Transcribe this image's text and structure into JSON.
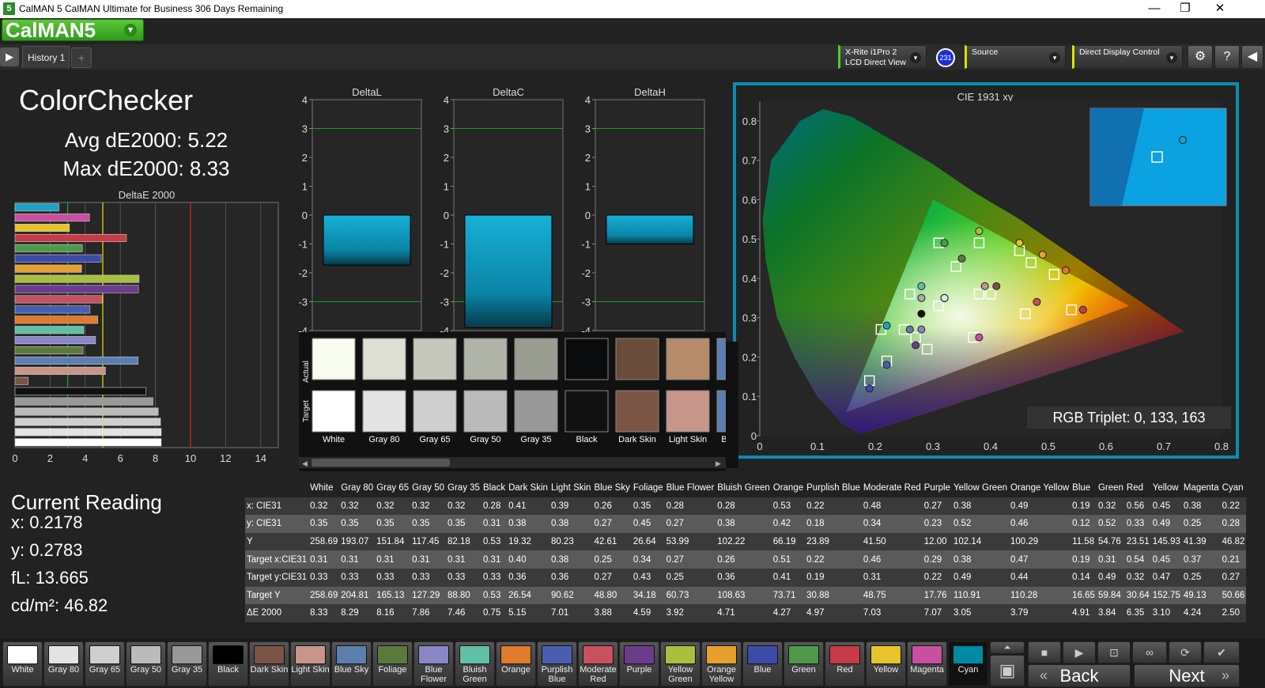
{
  "titlebar": {
    "title": "CalMAN 5 CalMAN Ultimate for Business 306 Days Remaining",
    "app_badge": "5",
    "minimize": "—",
    "restore": "❐",
    "close": "✕"
  },
  "logo": {
    "text": "CalMAN5",
    "dropdown": "▾"
  },
  "tabs": {
    "play": "▶",
    "history": "History 1",
    "add": "+"
  },
  "devices": {
    "meter_line1": "X-Rite i1Pro 2",
    "meter_line2": "LCD Direct View",
    "meter_badge": "231",
    "source": "Source",
    "display": "Direct Display Control",
    "chev": "▾"
  },
  "toolbar_icons": [
    "gear-icon",
    "help-icon",
    "collapse-icon"
  ],
  "toolbar_glyphs": {
    "gear": "⚙",
    "help": "?",
    "collapse": "◀"
  },
  "summary": {
    "title": "ColorChecker",
    "avg": "Avg dE2000: 5.22",
    "max": "Max dE2000: 8.33"
  },
  "current_reading": {
    "title": "Current Reading",
    "x": "x: 0.2178",
    "y": "y: 0.2783",
    "fl": "fL: 13.665",
    "cdm2": "cd/m²: 46.82"
  },
  "chart_data": [
    {
      "type": "bar",
      "title": "DeltaE 2000",
      "orientation": "horizontal",
      "xlim": [
        0,
        15
      ],
      "xticks": [
        0,
        2,
        4,
        6,
        8,
        10,
        12,
        14
      ],
      "reference_lines": [
        {
          "value": 3,
          "color": "#22aa22"
        },
        {
          "value": 5,
          "color": "#e8e000"
        },
        {
          "value": 10,
          "color": "#dd2222"
        }
      ],
      "categories": [
        "Cyan",
        "Magenta",
        "Yellow",
        "Red",
        "Green",
        "Blue",
        "Orange Yellow",
        "Yellow Green",
        "Purple",
        "Moderate Red",
        "Purplish Blue",
        "Orange",
        "Bluish Green",
        "Blue Flower",
        "Foliage",
        "Blue Sky",
        "Light Skin",
        "Dark Skin",
        "Black",
        "Gray 35",
        "Gray 50",
        "Gray 65",
        "Gray 80",
        "White"
      ],
      "values": [
        2.5,
        4.24,
        3.1,
        6.35,
        3.84,
        4.91,
        3.79,
        7.07,
        7.03,
        4.97,
        4.27,
        4.71,
        3.92,
        4.59,
        3.88,
        7.01,
        5.15,
        0.75,
        7.46,
        7.86,
        8.16,
        8.29,
        8.33,
        8.33
      ],
      "colors": [
        "#1ba3c6",
        "#c94fa0",
        "#e8c42a",
        "#c73a48",
        "#4e9a4a",
        "#3c4ba8",
        "#e7a02e",
        "#a8c03d",
        "#6b3c8c",
        "#c8505f",
        "#4a5db0",
        "#e07a2c",
        "#5fc0a8",
        "#8a86c8",
        "#5a7a3c",
        "#5c7fb0",
        "#c8958a",
        "#7a5444",
        "#111111",
        "#999999",
        "#bbbbbb",
        "#cfcfcf",
        "#e3e3e3",
        "#ffffff"
      ]
    },
    {
      "type": "bar",
      "title": "DeltaL",
      "ylim": [
        -4,
        4
      ],
      "yticks": [
        4,
        3,
        2,
        1,
        0,
        -1,
        -2,
        -3,
        -4
      ],
      "values": [
        -1.73
      ]
    },
    {
      "type": "bar",
      "title": "DeltaC",
      "ylim": [
        -4,
        4
      ],
      "yticks": [
        4,
        3,
        2,
        1,
        0,
        -1,
        -2,
        -3,
        -4
      ],
      "values": [
        -3.9
      ]
    },
    {
      "type": "bar",
      "title": "DeltaH",
      "ylim": [
        -4,
        4
      ],
      "yticks": [
        4,
        3,
        2,
        1,
        0,
        -1,
        -2,
        -3,
        -4
      ],
      "values": [
        -1.0
      ]
    },
    {
      "type": "scatter",
      "title": "CIE 1931 xy",
      "xlim": [
        0,
        0.8
      ],
      "ylim": [
        0,
        0.85
      ],
      "xticks": [
        0,
        0.1,
        0.2,
        0.3,
        0.4,
        0.5,
        0.6,
        0.7,
        0.8
      ],
      "yticks": [
        0,
        0.1,
        0.2,
        0.3,
        0.4,
        0.5,
        0.6,
        0.7,
        0.8
      ],
      "gamut": [
        [
          0.64,
          0.33
        ],
        [
          0.3,
          0.6
        ],
        [
          0.15,
          0.06
        ]
      ],
      "actual": [
        [
          0.22,
          0.28
        ],
        [
          0.38,
          0.25
        ],
        [
          0.45,
          0.49
        ],
        [
          0.56,
          0.32
        ],
        [
          0.32,
          0.49
        ],
        [
          0.19,
          0.12
        ],
        [
          0.49,
          0.46
        ],
        [
          0.38,
          0.52
        ],
        [
          0.27,
          0.23
        ],
        [
          0.48,
          0.34
        ],
        [
          0.22,
          0.18
        ],
        [
          0.53,
          0.42
        ],
        [
          0.28,
          0.38
        ],
        [
          0.28,
          0.27
        ],
        [
          0.35,
          0.45
        ],
        [
          0.26,
          0.27
        ],
        [
          0.39,
          0.38
        ],
        [
          0.41,
          0.38
        ],
        [
          0.28,
          0.35
        ],
        [
          0.32,
          0.35
        ],
        [
          0.32,
          0.35
        ],
        [
          0.32,
          0.35
        ],
        [
          0.32,
          0.35
        ],
        [
          0.28,
          0.31
        ]
      ],
      "actual_colors": [
        "#1ba3c6",
        "#c94fa0",
        "#e8c42a",
        "#c73a48",
        "#4e9a4a",
        "#3c4ba8",
        "#e7a02e",
        "#a8c03d",
        "#6b3c8c",
        "#c8505f",
        "#4a5db0",
        "#e07a2c",
        "#5fc0a8",
        "#8a86c8",
        "#5a7a3c",
        "#5c7fb0",
        "#c8958a",
        "#7a5444",
        "#aaaaaa",
        "#999999",
        "#bbbbbb",
        "#cfcfcf",
        "#e3e3e3",
        "#111111"
      ],
      "target": [
        [
          0.21,
          0.27
        ],
        [
          0.37,
          0.25
        ],
        [
          0.45,
          0.47
        ],
        [
          0.54,
          0.32
        ],
        [
          0.31,
          0.49
        ],
        [
          0.19,
          0.14
        ],
        [
          0.47,
          0.44
        ],
        [
          0.38,
          0.49
        ],
        [
          0.29,
          0.22
        ],
        [
          0.46,
          0.31
        ],
        [
          0.22,
          0.19
        ],
        [
          0.51,
          0.41
        ],
        [
          0.26,
          0.36
        ],
        [
          0.27,
          0.25
        ],
        [
          0.34,
          0.43
        ],
        [
          0.25,
          0.27
        ],
        [
          0.38,
          0.36
        ],
        [
          0.4,
          0.36
        ],
        [
          0.31,
          0.33
        ]
      ],
      "inset_actual": [
        [
          0.22,
          0.28
        ]
      ],
      "inset_target": [
        [
          0.21,
          0.27
        ]
      ],
      "readout": "RGB Triplet: 0, 133, 163"
    }
  ],
  "swatches": {
    "actual_label": "Actual",
    "target_label": "Target",
    "items": [
      {
        "name": "White",
        "actual": "#f8fbef",
        "target": "#ffffff"
      },
      {
        "name": "Gray 80",
        "actual": "#dcdfd2",
        "target": "#e3e3e3"
      },
      {
        "name": "Gray 65",
        "actual": "#c6c8bc",
        "target": "#cfcfcf"
      },
      {
        "name": "Gray 50",
        "actual": "#b0b3a7",
        "target": "#bbbbbb"
      },
      {
        "name": "Gray 35",
        "actual": "#9a9d91",
        "target": "#999999"
      },
      {
        "name": "Black",
        "actual": "#0a0c0e",
        "target": "#111111"
      },
      {
        "name": "Dark Skin",
        "actual": "#6a4c3a",
        "target": "#7a5444"
      },
      {
        "name": "Light Skin",
        "actual": "#b58b6c",
        "target": "#c8958a"
      },
      {
        "name": "Blue Sky",
        "actual": "#5c7fb0",
        "target": "#5c7fb0"
      }
    ]
  },
  "table": {
    "headers": [
      "White",
      "Gray 80",
      "Gray 65",
      "Gray 50",
      "Gray 35",
      "Black",
      "Dark Skin",
      "Light Skin",
      "Blue Sky",
      "Foliage",
      "Blue Flower",
      "Bluish Green",
      "Orange",
      "Purplish Blue",
      "Moderate Red",
      "Purple",
      "Yellow Green",
      "Orange Yellow",
      "Blue",
      "Green",
      "Red",
      "Yellow",
      "Magenta",
      "Cyan"
    ],
    "rows": [
      {
        "label": "x: CIE31",
        "values": [
          "0.32",
          "0.32",
          "0.32",
          "0.32",
          "0.32",
          "0.28",
          "0.41",
          "0.39",
          "0.26",
          "0.35",
          "0.28",
          "0.28",
          "0.53",
          "0.22",
          "0.48",
          "0.27",
          "0.38",
          "0.49",
          "0.19",
          "0.32",
          "0.56",
          "0.45",
          "0.38",
          "0.22"
        ]
      },
      {
        "label": "y: CIE31",
        "values": [
          "0.35",
          "0.35",
          "0.35",
          "0.35",
          "0.35",
          "0.31",
          "0.38",
          "0.38",
          "0.27",
          "0.45",
          "0.27",
          "0.38",
          "0.42",
          "0.18",
          "0.34",
          "0.23",
          "0.52",
          "0.46",
          "0.12",
          "0.52",
          "0.33",
          "0.49",
          "0.25",
          "0.28"
        ]
      },
      {
        "label": "Y",
        "values": [
          "258.69",
          "193.07",
          "151.84",
          "117.45",
          "82.18",
          "0.53",
          "19.32",
          "80.23",
          "42.61",
          "26.64",
          "53.99",
          "102.22",
          "66.19",
          "23.89",
          "41.50",
          "12.00",
          "102.14",
          "100.29",
          "11.58",
          "54.76",
          "23.51",
          "145.93",
          "41.39",
          "46.82"
        ]
      },
      {
        "label": "Target x:CIE31",
        "values": [
          "0.31",
          "0.31",
          "0.31",
          "0.31",
          "0.31",
          "0.31",
          "0.40",
          "0.38",
          "0.25",
          "0.34",
          "0.27",
          "0.26",
          "0.51",
          "0.22",
          "0.46",
          "0.29",
          "0.38",
          "0.47",
          "0.19",
          "0.31",
          "0.54",
          "0.45",
          "0.37",
          "0.21"
        ]
      },
      {
        "label": "Target y:CIE31",
        "values": [
          "0.33",
          "0.33",
          "0.33",
          "0.33",
          "0.33",
          "0.33",
          "0.36",
          "0.36",
          "0.27",
          "0.43",
          "0.25",
          "0.36",
          "0.41",
          "0.19",
          "0.31",
          "0.22",
          "0.49",
          "0.44",
          "0.14",
          "0.49",
          "0.32",
          "0.47",
          "0.25",
          "0.27"
        ]
      },
      {
        "label": "Target Y",
        "values": [
          "258.69",
          "204.81",
          "165.13",
          "127.29",
          "88.80",
          "0.53",
          "26.54",
          "90.62",
          "48.80",
          "34.18",
          "60.73",
          "108.63",
          "73.71",
          "30.88",
          "48.75",
          "17.76",
          "110.91",
          "110.28",
          "16.65",
          "59.84",
          "30.64",
          "152.75",
          "49.13",
          "50.66"
        ]
      },
      {
        "label": "ΔE 2000",
        "values": [
          "8.33",
          "8.29",
          "8.16",
          "7.86",
          "7.46",
          "0.75",
          "5.15",
          "7.01",
          "3.88",
          "4.59",
          "3.92",
          "4.71",
          "4.27",
          "4.97",
          "7.03",
          "7.07",
          "3.05",
          "3.79",
          "4.91",
          "3.84",
          "6.35",
          "3.10",
          "4.24",
          "2.50"
        ]
      }
    ]
  },
  "bottom": {
    "swatches": [
      {
        "label": "White",
        "color": "#ffffff"
      },
      {
        "label": "Gray 80",
        "color": "#e3e3e3"
      },
      {
        "label": "Gray 65",
        "color": "#cfcfcf"
      },
      {
        "label": "Gray 50",
        "color": "#bbbbbb"
      },
      {
        "label": "Gray 35",
        "color": "#999999"
      },
      {
        "label": "Black",
        "color": "#000000"
      },
      {
        "label": "Dark Skin",
        "color": "#7a5444"
      },
      {
        "label": "Light Skin",
        "color": "#c8958a"
      },
      {
        "label": "Blue Sky",
        "color": "#5c7fb0"
      },
      {
        "label": "Foliage",
        "color": "#5a7a3c"
      },
      {
        "label": "Blue Flower",
        "color": "#8a86c8"
      },
      {
        "label": "Bluish Green",
        "color": "#5fc0a8"
      },
      {
        "label": "Orange",
        "color": "#e07a2c"
      },
      {
        "label": "Purplish Blue",
        "color": "#4a5db0"
      },
      {
        "label": "Moderate Red",
        "color": "#c8505f"
      },
      {
        "label": "Purple",
        "color": "#6b3c8c"
      },
      {
        "label": "Yellow Green",
        "color": "#a8c03d"
      },
      {
        "label": "Orange Yellow",
        "color": "#e7a02e"
      },
      {
        "label": "Blue",
        "color": "#3c4ba8"
      },
      {
        "label": "Green",
        "color": "#4e9a4a"
      },
      {
        "label": "Red",
        "color": "#c73a48"
      },
      {
        "label": "Yellow",
        "color": "#e8c42a"
      },
      {
        "label": "Magenta",
        "color": "#c94fa0"
      },
      {
        "label": "Cyan",
        "color": "#0089a3"
      }
    ],
    "selected": "Cyan",
    "back": "Back",
    "next": "Next",
    "back_glyph": "«",
    "next_glyph": "»",
    "ctl_glyphs": {
      "up": "⏶",
      "stop": "■",
      "play": "▶",
      "fit": "⊡",
      "loop": "∞",
      "refresh": "⟳",
      "check": "✔",
      "square": "▣"
    }
  },
  "accent": "#0b8bb0"
}
